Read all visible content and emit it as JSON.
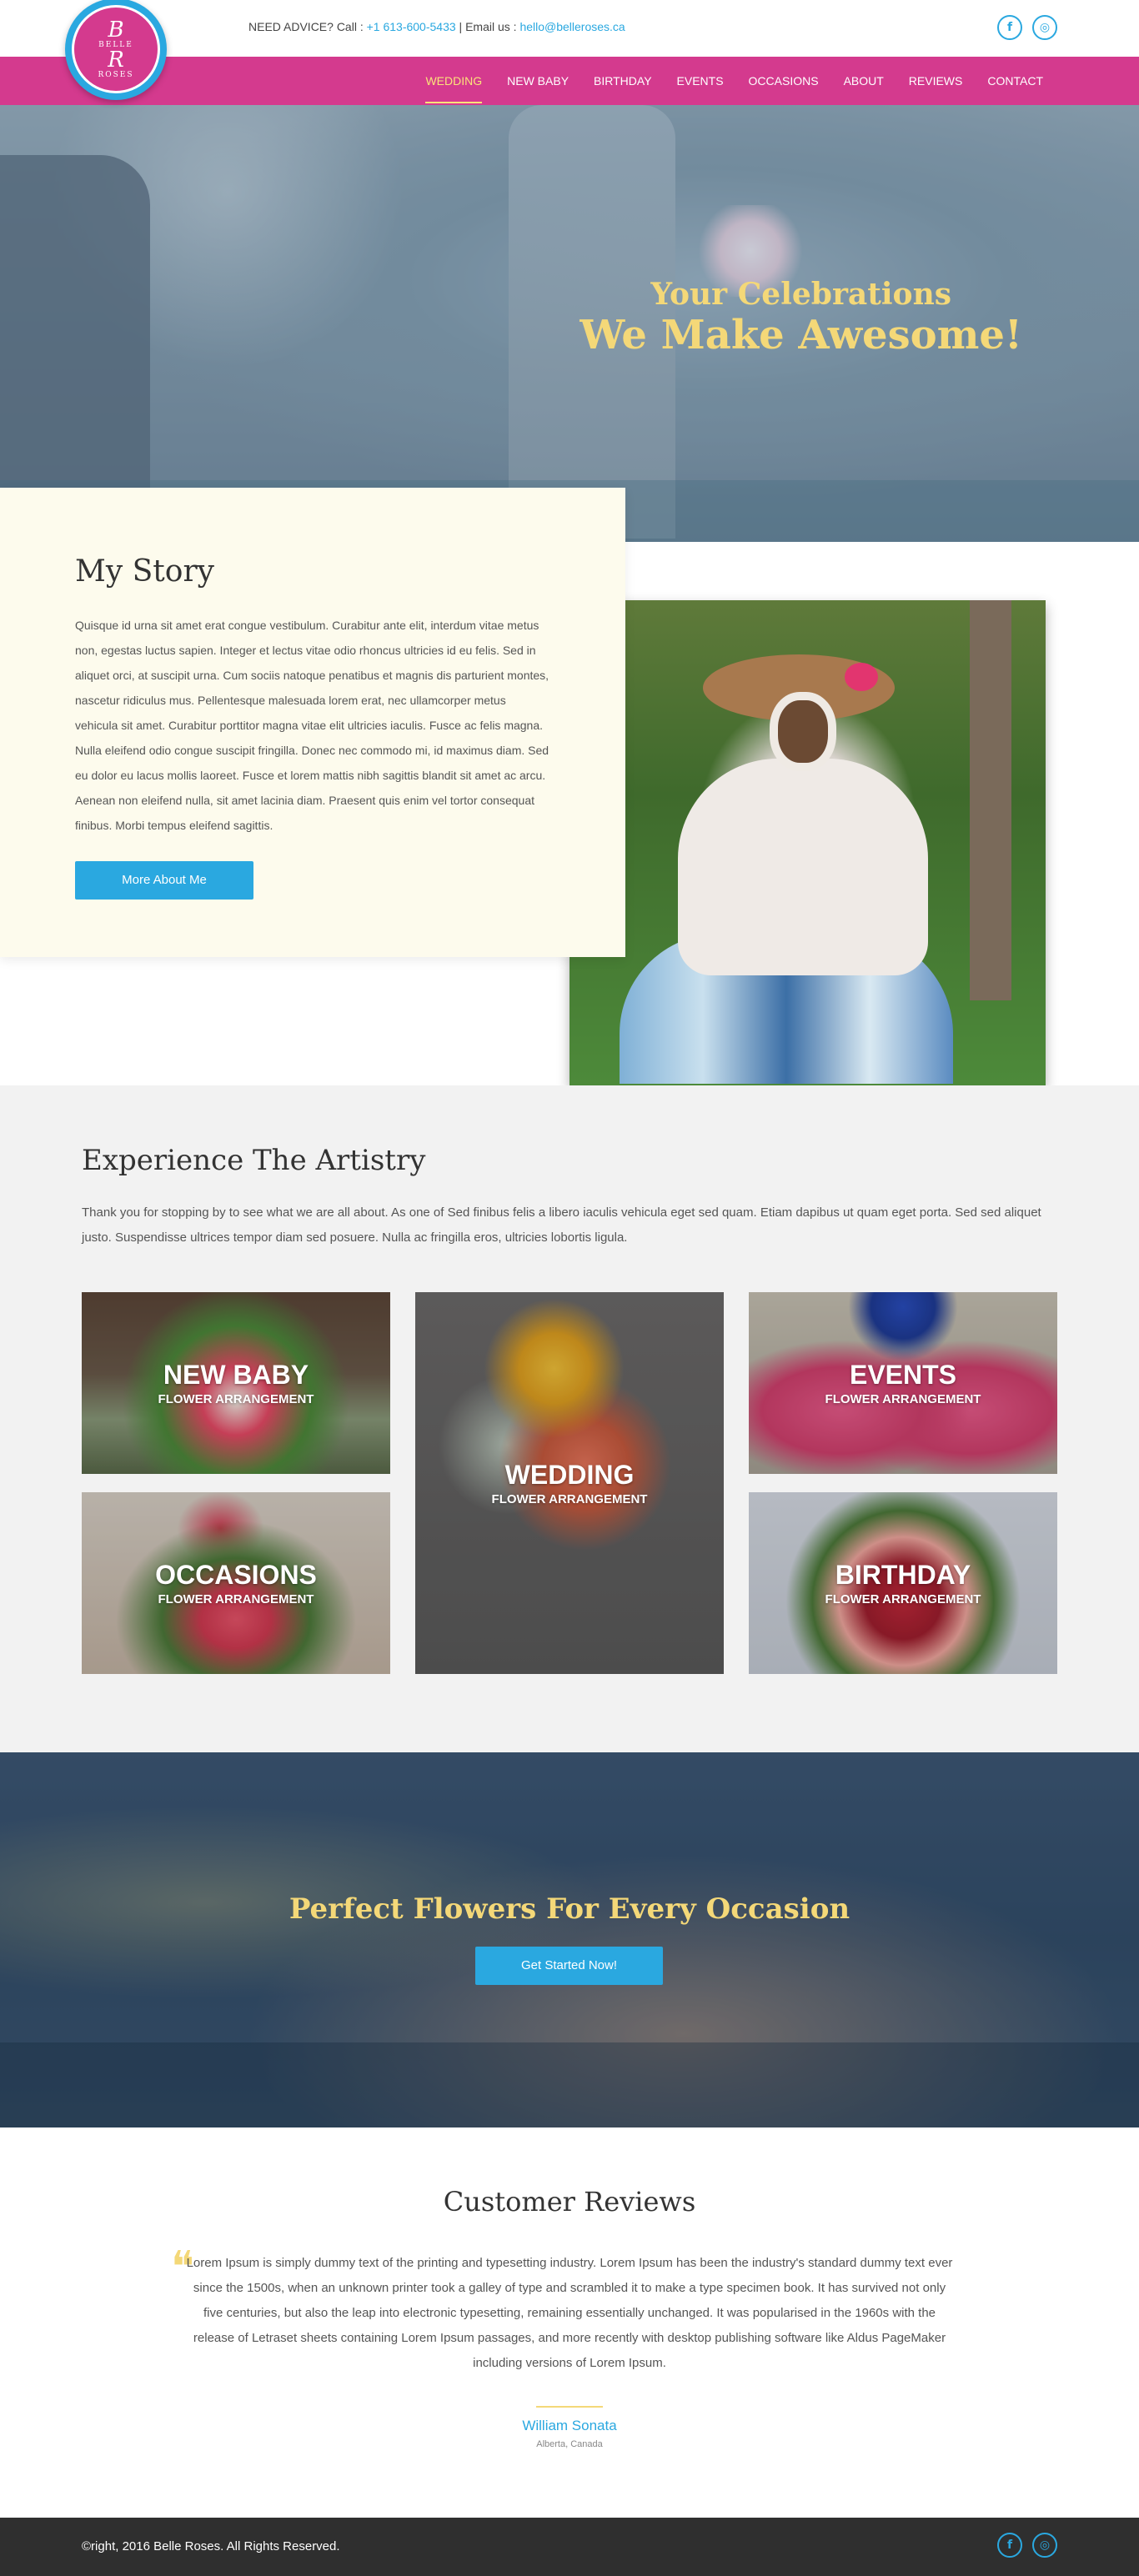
{
  "header": {
    "logo_text": "Belle Roses",
    "advice_label": "NEED ADVICE? Call : ",
    "phone": "+1 613-600-5433",
    "separator": " | Email us : ",
    "email": "hello@belleroses.ca",
    "social": [
      {
        "icon": "facebook-icon",
        "glyph": "f"
      },
      {
        "icon": "instagram-icon",
        "glyph": "◎"
      }
    ]
  },
  "nav": {
    "items": [
      {
        "label": "WEDDING",
        "active": true
      },
      {
        "label": "NEW BABY"
      },
      {
        "label": "BIRTHDAY"
      },
      {
        "label": "EVENTS"
      },
      {
        "label": "OCCASIONS"
      },
      {
        "label": "ABOUT"
      },
      {
        "label": "REVIEWS"
      },
      {
        "label": "CONTACT"
      }
    ]
  },
  "hero": {
    "line1": "Your Celebrations",
    "line2": "We Make Awesome!"
  },
  "story": {
    "title": "My Story",
    "body": "Quisque id urna sit amet erat congue vestibulum. Curabitur ante elit, interdum vitae metus non, egestas luctus sapien. Integer et lectus vitae odio rhoncus ultricies id eu felis. Sed in aliquet orci, at suscipit urna. Cum sociis natoque penatibus et magnis dis parturient montes, nascetur ridiculus mus. Pellentesque malesuada lorem erat, nec ullamcorper metus vehicula sit amet. Curabitur porttitor magna vitae elit ultricies iaculis. Fusce ac felis magna. Nulla eleifend odio congue suscipit fringilla. Donec nec commodo mi, id maximus diam. Sed eu dolor eu lacus mollis laoreet. Fusce et lorem mattis nibh sagittis blandit sit amet ac arcu. Aenean non eleifend nulla, sit amet lacinia diam. Praesent quis enim vel tortor consequat finibus. Morbi tempus eleifend sagittis.",
    "button": "More About Me"
  },
  "artistry": {
    "title": "Experience The Artistry",
    "body": "Thank you for stopping by to see what we are all about. As one of Sed finibus felis a libero iaculis vehicula eget sed quam. Etiam dapibus ut quam eget porta. Sed sed aliquet justo. Suspendisse ultrices tempor diam sed posuere. Nulla ac fringilla eros, ultricies lobortis ligula.",
    "tiles": {
      "new_baby": {
        "title": "NEW BABY",
        "subtitle": "FLOWER ARRANGEMENT"
      },
      "wedding": {
        "title": "WEDDING",
        "subtitle": "FLOWER ARRANGEMENT"
      },
      "events": {
        "title": "EVENTS",
        "subtitle": "FLOWER ARRANGEMENT"
      },
      "occasions": {
        "title": "OCCASIONS",
        "subtitle": "FLOWER ARRANGEMENT"
      },
      "birthday": {
        "title": "BIRTHDAY",
        "subtitle": "FLOWER ARRANGEMENT"
      }
    }
  },
  "cta": {
    "title": "Perfect Flowers For Every Occasion",
    "button": "Get Started Now!"
  },
  "reviews": {
    "title": "Customer Reviews",
    "quote": "Lorem Ipsum is simply dummy text of the printing and typesetting industry. Lorem Ipsum has been the industry's standard dummy text ever since the 1500s, when an unknown printer took a galley of type and scrambled it to make a type specimen book. It has survived not only five centuries, but also the leap into electronic typesetting, remaining essentially unchanged. It was popularised in the 1960s with the release of Letraset sheets containing Lorem Ipsum passages, and more recently with desktop publishing software like Aldus PageMaker including versions of Lorem Ipsum.",
    "author": "William Sonata",
    "location": "Alberta, Canada"
  },
  "footer": {
    "copyright": "©right, 2016 Belle Roses. All Rights Reserved."
  },
  "colors": {
    "brand_pink": "#d43a8e",
    "accent_blue": "#2aa8e0",
    "accent_gold": "#f4d878"
  }
}
